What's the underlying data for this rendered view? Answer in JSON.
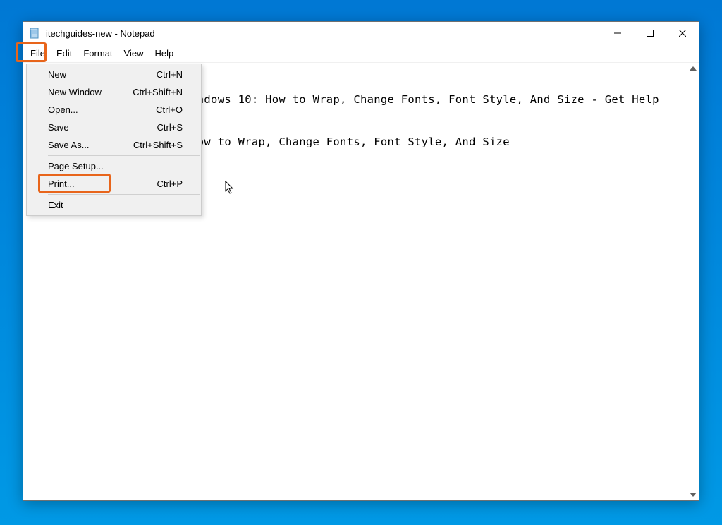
{
  "window": {
    "title": "itechguides-new - Notepad"
  },
  "menubar": {
    "items": [
      {
        "label": "File",
        "active": true
      },
      {
        "label": "Edit",
        "active": false
      },
      {
        "label": "Format",
        "active": false
      },
      {
        "label": "View",
        "active": false
      },
      {
        "label": "Help",
        "active": false
      }
    ]
  },
  "dropdown": {
    "items": [
      {
        "label": "New",
        "shortcut": "Ctrl+N",
        "type": "item"
      },
      {
        "label": "New Window",
        "shortcut": "Ctrl+Shift+N",
        "type": "item"
      },
      {
        "label": "Open...",
        "shortcut": "Ctrl+O",
        "type": "item"
      },
      {
        "label": "Save",
        "shortcut": "Ctrl+S",
        "type": "item"
      },
      {
        "label": "Save As...",
        "shortcut": "Ctrl+Shift+S",
        "type": "item"
      },
      {
        "type": "separator"
      },
      {
        "label": "Page Setup...",
        "shortcut": "",
        "type": "item"
      },
      {
        "label": "Print...",
        "shortcut": "Ctrl+P",
        "type": "item",
        "highlighted": true
      },
      {
        "type": "separator"
      },
      {
        "label": "Exit",
        "shortcut": "",
        "type": "item"
      }
    ]
  },
  "editor": {
    "lines": [
      "Format Text In Notepad Windows 10: How to Wrap, Change Fonts, Font Style, And Size - Get Help",
      "Format Text In Notepad: How to Wrap, Change Fonts, Font Style, And Size"
    ]
  },
  "highlights": {
    "color": "#e8651b"
  }
}
